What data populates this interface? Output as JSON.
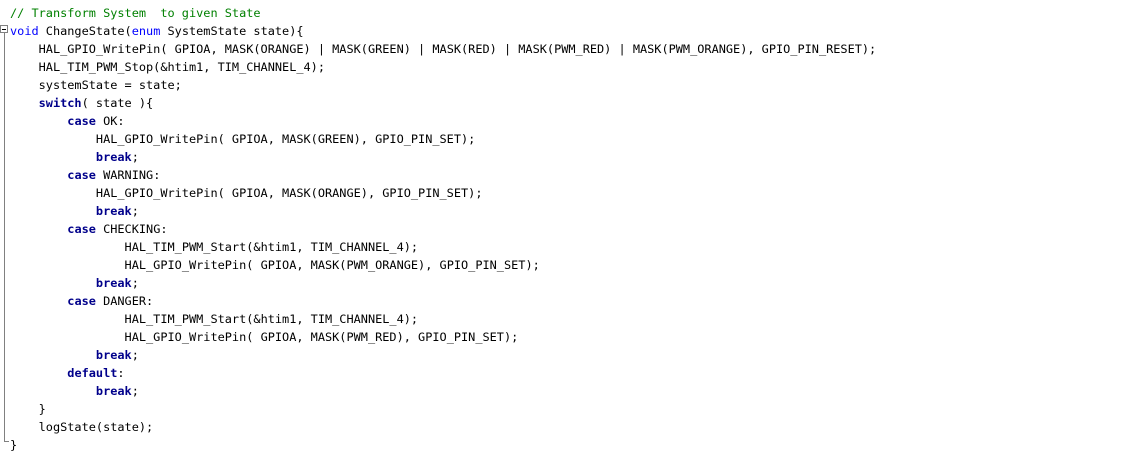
{
  "editor": {
    "language": "C",
    "colors": {
      "background": "#ffffff",
      "comment": "#008000",
      "keyword": "#0000ff",
      "control_keyword": "#00008b",
      "text": "#000000",
      "fold_guide": "#808080"
    },
    "lines": [
      {
        "indent": "",
        "parts": [
          {
            "t": "cmt",
            "v": "// Transform System  to given State"
          }
        ]
      },
      {
        "indent": "",
        "parts": [
          {
            "t": "kw",
            "v": "void"
          },
          {
            "t": "txt",
            "v": " ChangeState("
          },
          {
            "t": "kw",
            "v": "enum"
          },
          {
            "t": "txt",
            "v": " SystemState state){"
          }
        ]
      },
      {
        "indent": "    ",
        "parts": [
          {
            "t": "txt",
            "v": "HAL_GPIO_WritePin( GPIOA, MASK(ORANGE) | MASK(GREEN) | MASK(RED) | MASK(PWM_RED) | MASK(PWM_ORANGE), GPIO_PIN_RESET);"
          }
        ]
      },
      {
        "indent": "    ",
        "parts": [
          {
            "t": "txt",
            "v": "HAL_TIM_PWM_Stop(&htim1, TIM_CHANNEL_4);"
          }
        ]
      },
      {
        "indent": "    ",
        "parts": [
          {
            "t": "txt",
            "v": "systemState = state;"
          }
        ]
      },
      {
        "indent": "    ",
        "parts": [
          {
            "t": "kwb",
            "v": "switch"
          },
          {
            "t": "txt",
            "v": "( state ){"
          }
        ]
      },
      {
        "indent": "        ",
        "parts": [
          {
            "t": "kwb",
            "v": "case"
          },
          {
            "t": "txt",
            "v": " OK:"
          }
        ]
      },
      {
        "indent": "            ",
        "parts": [
          {
            "t": "txt",
            "v": "HAL_GPIO_WritePin( GPIOA, MASK(GREEN), GPIO_PIN_SET);"
          }
        ]
      },
      {
        "indent": "            ",
        "parts": [
          {
            "t": "kwb",
            "v": "break"
          },
          {
            "t": "txt",
            "v": ";"
          }
        ]
      },
      {
        "indent": "        ",
        "parts": [
          {
            "t": "kwb",
            "v": "case"
          },
          {
            "t": "txt",
            "v": " WARNING:"
          }
        ]
      },
      {
        "indent": "            ",
        "parts": [
          {
            "t": "txt",
            "v": "HAL_GPIO_WritePin( GPIOA, MASK(ORANGE), GPIO_PIN_SET);"
          }
        ]
      },
      {
        "indent": "            ",
        "parts": [
          {
            "t": "kwb",
            "v": "break"
          },
          {
            "t": "txt",
            "v": ";"
          }
        ]
      },
      {
        "indent": "        ",
        "parts": [
          {
            "t": "kwb",
            "v": "case"
          },
          {
            "t": "txt",
            "v": " CHECKING:"
          }
        ]
      },
      {
        "indent": "                ",
        "parts": [
          {
            "t": "txt",
            "v": "HAL_TIM_PWM_Start(&htim1, TIM_CHANNEL_4);"
          }
        ]
      },
      {
        "indent": "                ",
        "parts": [
          {
            "t": "txt",
            "v": "HAL_GPIO_WritePin( GPIOA, MASK(PWM_ORANGE), GPIO_PIN_SET);"
          }
        ]
      },
      {
        "indent": "            ",
        "parts": [
          {
            "t": "kwb",
            "v": "break"
          },
          {
            "t": "txt",
            "v": ";"
          }
        ]
      },
      {
        "indent": "        ",
        "parts": [
          {
            "t": "kwb",
            "v": "case"
          },
          {
            "t": "txt",
            "v": " DANGER:"
          }
        ]
      },
      {
        "indent": "                ",
        "parts": [
          {
            "t": "txt",
            "v": "HAL_TIM_PWM_Start(&htim1, TIM_CHANNEL_4);"
          }
        ]
      },
      {
        "indent": "                ",
        "parts": [
          {
            "t": "txt",
            "v": "HAL_GPIO_WritePin( GPIOA, MASK(PWM_RED), GPIO_PIN_SET);"
          }
        ]
      },
      {
        "indent": "            ",
        "parts": [
          {
            "t": "kwb",
            "v": "break"
          },
          {
            "t": "txt",
            "v": ";"
          }
        ]
      },
      {
        "indent": "        ",
        "parts": [
          {
            "t": "kwb",
            "v": "default"
          },
          {
            "t": "txt",
            "v": ":"
          }
        ]
      },
      {
        "indent": "            ",
        "parts": [
          {
            "t": "kwb",
            "v": "break"
          },
          {
            "t": "txt",
            "v": ";"
          }
        ]
      },
      {
        "indent": "    ",
        "parts": [
          {
            "t": "txt",
            "v": "}"
          }
        ]
      },
      {
        "indent": "    ",
        "parts": [
          {
            "t": "txt",
            "v": "logState(state);"
          }
        ]
      },
      {
        "indent": "",
        "parts": [
          {
            "t": "txt",
            "v": "}"
          }
        ]
      }
    ]
  }
}
